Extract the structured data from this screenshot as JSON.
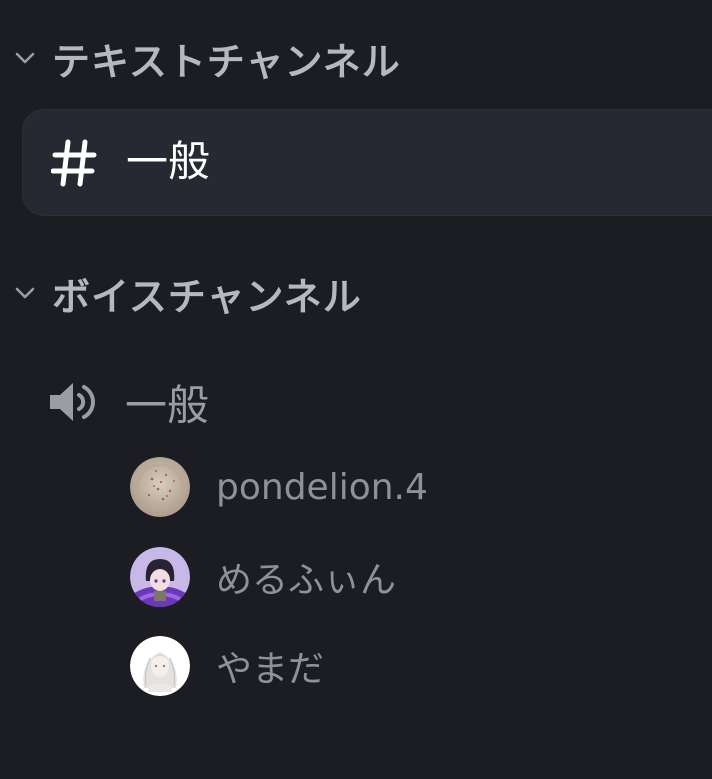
{
  "categories": [
    {
      "label": "テキストチャンネル",
      "icon": "chevron-down-icon"
    },
    {
      "label": "ボイスチャンネル",
      "icon": "chevron-down-icon"
    }
  ],
  "text_channels": [
    {
      "label": "一般",
      "icon": "hash-icon",
      "selected": true
    }
  ],
  "voice_channels": [
    {
      "label": "一般",
      "icon": "speaker-icon"
    }
  ],
  "voice_members": [
    {
      "name": "pondelion.4",
      "avatar": "beige-textured-avatar"
    },
    {
      "name": "めるふぃん",
      "avatar": "purple-anime-avatar"
    },
    {
      "name": "やまだ",
      "avatar": "white-sketch-avatar"
    }
  ],
  "colors": {
    "background": "#1c1d23",
    "selected_channel_bg": "#272932",
    "category_text": "#b5b8c0",
    "channel_text_active": "#ffffff",
    "channel_text_muted": "#9a9da6",
    "member_text": "#8e919b"
  }
}
